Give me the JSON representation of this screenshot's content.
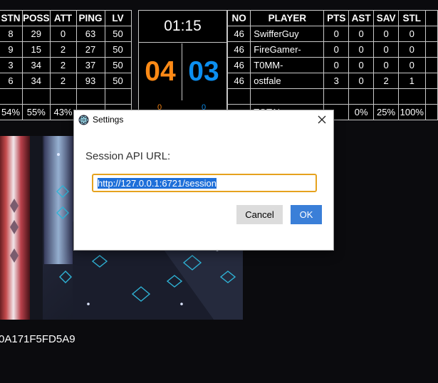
{
  "left_table": {
    "headers": [
      "STN",
      "POSS",
      "ATT",
      "PING",
      "LV"
    ],
    "rows": [
      [
        "8",
        "29",
        "0",
        "63",
        "50"
      ],
      [
        "9",
        "15",
        "2",
        "27",
        "50"
      ],
      [
        "3",
        "34",
        "2",
        "37",
        "50"
      ],
      [
        "6",
        "34",
        "2",
        "93",
        "50"
      ]
    ],
    "totals": [
      "54%",
      "55%",
      "43%"
    ]
  },
  "scoreboard": {
    "clock": "01:15",
    "orange_score": "04",
    "blue_score": "03",
    "orange_sub": "0",
    "blue_sub": "0",
    "orange_color": "#ff8a16",
    "blue_color": "#0c8ff0"
  },
  "right_table": {
    "headers": [
      "NO",
      "PLAYER",
      "PTS",
      "AST",
      "SAV",
      "STL"
    ],
    "rows": [
      [
        "46",
        "SwifferGuy",
        "0",
        "0",
        "0",
        "0"
      ],
      [
        "46",
        "FireGamer-",
        "0",
        "0",
        "0",
        "0"
      ],
      [
        "46",
        "T0MM-",
        "0",
        "0",
        "0",
        "0"
      ],
      [
        "46",
        "ostfale",
        "3",
        "0",
        "2",
        "1"
      ]
    ],
    "totals_label": "TOTAL",
    "totals": [
      "0%",
      "25%",
      "100%"
    ]
  },
  "session_id_text": "0A171F5FD5A9",
  "dialog": {
    "title": "Settings",
    "field_label": "Session API URL:",
    "url_value": "http://127.0.0.1:6721/session",
    "cancel_label": "Cancel",
    "ok_label": "OK",
    "accent_color": "#e6a21e",
    "primary_button_color": "#3a7fd8"
  },
  "icons": {
    "app": "electron-icon",
    "close": "close-icon"
  }
}
